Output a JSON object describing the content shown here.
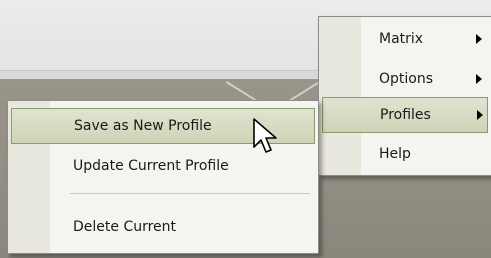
{
  "main_menu": {
    "items": [
      {
        "label": "Matrix",
        "has_submenu": true
      },
      {
        "label": "Options",
        "has_submenu": true
      },
      {
        "label": "Profiles",
        "has_submenu": true,
        "highlighted": true
      },
      {
        "label": "Help",
        "has_submenu": false
      }
    ]
  },
  "profiles_submenu": {
    "items": [
      {
        "label": "Save as New Profile",
        "highlighted": true
      },
      {
        "label": "Update Current Profile"
      },
      {
        "label": "Delete Current"
      }
    ]
  },
  "icons": {
    "cursor": "arrow-cursor-icon",
    "submenu_arrow": "chevron-right-icon"
  },
  "colors": {
    "menu_bg": "#f4f4f0",
    "highlight": "#d6dcc2",
    "highlight_border": "#8e9a6e",
    "app_body": "#958f85"
  }
}
